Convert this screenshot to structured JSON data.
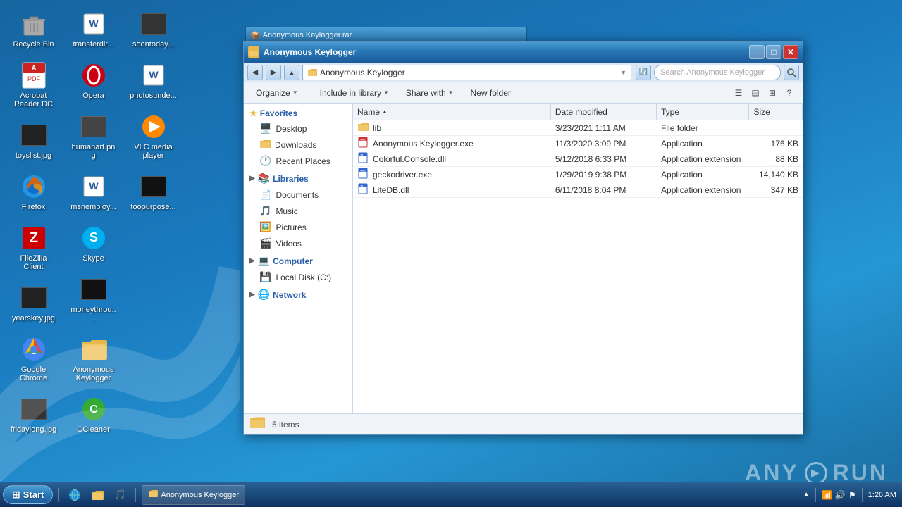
{
  "desktop": {
    "background": "#1a6b9f",
    "icons": [
      {
        "id": "recycle-bin",
        "label": "Recycle Bin",
        "icon": "🗑️",
        "type": "system"
      },
      {
        "id": "acrobat",
        "label": "Acrobat Reader DC",
        "icon": "📕",
        "type": "app"
      },
      {
        "id": "toyslist",
        "label": "toyslist.jpg",
        "icon": "🖼️",
        "type": "file"
      },
      {
        "id": "firefox",
        "label": "Firefox",
        "icon": "🦊",
        "type": "app"
      },
      {
        "id": "filezilla",
        "label": "FileZilla Client",
        "icon": "📂",
        "type": "app"
      },
      {
        "id": "yearskey",
        "label": "yearskey.jpg",
        "icon": "🖼️",
        "type": "file"
      },
      {
        "id": "chrome",
        "label": "Google Chrome",
        "icon": "🌐",
        "type": "app"
      },
      {
        "id": "fridaylong",
        "label": "fridaylong.jpg",
        "icon": "🖼️",
        "type": "file"
      },
      {
        "id": "transferdir",
        "label": "transferdir...",
        "icon": "📄",
        "type": "file"
      },
      {
        "id": "opera",
        "label": "Opera",
        "icon": "O",
        "type": "app"
      },
      {
        "id": "humanart",
        "label": "humanart.png",
        "icon": "🖼️",
        "type": "file"
      },
      {
        "id": "msnemploy",
        "label": "msnemploy...",
        "icon": "📄",
        "type": "file"
      },
      {
        "id": "skype",
        "label": "Skype",
        "icon": "S",
        "type": "app"
      },
      {
        "id": "moneythrou",
        "label": "moneythrou...",
        "icon": "■",
        "type": "file"
      },
      {
        "id": "anonymous-keylogger-icon",
        "label": "Anonymous Keylogger",
        "icon": "📁",
        "type": "folder"
      },
      {
        "id": "ccleaner",
        "label": "CCleaner",
        "icon": "🔄",
        "type": "app"
      },
      {
        "id": "soontoday",
        "label": "soontoday...",
        "icon": "📄",
        "type": "file"
      },
      {
        "id": "photosunde",
        "label": "photosunde...",
        "icon": "📄",
        "type": "file"
      },
      {
        "id": "vlc",
        "label": "VLC media player",
        "icon": "▶",
        "type": "app"
      },
      {
        "id": "toopurpose",
        "label": "toopurpose...",
        "icon": "■",
        "type": "file"
      }
    ]
  },
  "rar_window": {
    "title": "Anonymous Keylogger.rar",
    "icon": "📦"
  },
  "explorer": {
    "title": "Anonymous Keylogger",
    "address": "Anonymous Keylogger",
    "search_placeholder": "Search Anonymous Keylogger",
    "toolbar": {
      "organize_label": "Organize",
      "include_library_label": "Include in library",
      "share_with_label": "Share with",
      "new_folder_label": "New folder"
    },
    "columns": {
      "name": "Name",
      "date_modified": "Date modified",
      "type": "Type",
      "size": "Size"
    },
    "nav": {
      "favorites_label": "Favorites",
      "desktop_label": "Desktop",
      "downloads_label": "Downloads",
      "recent_places_label": "Recent Places",
      "libraries_label": "Libraries",
      "documents_label": "Documents",
      "music_label": "Music",
      "pictures_label": "Pictures",
      "videos_label": "Videos",
      "computer_label": "Computer",
      "local_disk_label": "Local Disk (C:)",
      "network_label": "Network"
    },
    "files": [
      {
        "id": "lib",
        "name": "lib",
        "date_modified": "3/23/2021 1:11 AM",
        "type": "File folder",
        "size": "",
        "icon": "folder"
      },
      {
        "id": "anonymous-keylogger-exe",
        "name": "Anonymous Keylogger.exe",
        "date_modified": "11/3/2020 3:09 PM",
        "type": "Application",
        "size": "176 KB",
        "icon": "exe"
      },
      {
        "id": "colorful-console-dll",
        "name": "Colorful.Console.dll",
        "date_modified": "5/12/2018 6:33 PM",
        "type": "Application extension",
        "size": "88 KB",
        "icon": "dll"
      },
      {
        "id": "geckodriver-exe",
        "name": "geckodriver.exe",
        "date_modified": "1/29/2019 9:38 PM",
        "type": "Application",
        "size": "14,140 KB",
        "icon": "exe"
      },
      {
        "id": "litedb-dll",
        "name": "LiteDB.dll",
        "date_modified": "6/11/2018 8:04 PM",
        "type": "Application extension",
        "size": "347 KB",
        "icon": "dll"
      }
    ],
    "status": "5 items"
  },
  "taskbar": {
    "start_label": "Start",
    "time": "1:26 AM",
    "quick_launch": [
      {
        "id": "ie-quick",
        "icon": "🌐",
        "label": "Internet Explorer"
      },
      {
        "id": "folder-quick",
        "icon": "📁",
        "label": "Windows Explorer"
      },
      {
        "id": "winamp-quick",
        "icon": "🎵",
        "label": "Media Player"
      }
    ],
    "active_items": [
      {
        "id": "anonymous-keylogger-task",
        "label": "Anonymous Keylogger",
        "icon": "📁"
      }
    ]
  },
  "watermark": {
    "text": "ANY",
    "run_text": "RUN"
  }
}
